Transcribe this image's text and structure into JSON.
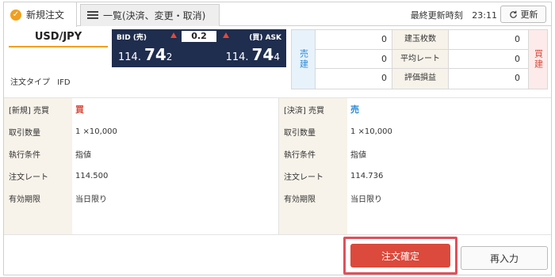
{
  "tabs": [
    {
      "label": "新規注文",
      "icon": "check-circle-icon"
    },
    {
      "label": "一覧(決済、変更・取消)",
      "icon": "list-icon"
    }
  ],
  "header": {
    "updated_label": "最終更新時刻",
    "updated_time": "23:11",
    "refresh_label": "更新"
  },
  "symbol": "USD/JPY",
  "order_type": {
    "label": "注文タイプ",
    "value": "IFD"
  },
  "quote": {
    "bid_label": "BID (売)",
    "ask_label": "(買) ASK",
    "spread": "0.2",
    "bid": {
      "big": "114.",
      "main": "74",
      "small": "2"
    },
    "ask": {
      "big": "114.",
      "main": "74",
      "small": "4"
    }
  },
  "position": {
    "sell_label": "売建",
    "buy_label": "買建",
    "rows": [
      {
        "label": "建玉枚数",
        "sell": "0",
        "buy": "0"
      },
      {
        "label": "平均レート",
        "sell": "0",
        "buy": "0"
      },
      {
        "label": "評価損益",
        "sell": "0",
        "buy": "0"
      }
    ]
  },
  "new_order": {
    "rows": [
      {
        "label": "[新規] 売買",
        "value": "買"
      },
      {
        "label": "取引数量",
        "value": "1 ×10,000"
      },
      {
        "label": "執行条件",
        "value": "指値"
      },
      {
        "label": "注文レート",
        "value": "114.500"
      },
      {
        "label": "有効期限",
        "value": "当日限り"
      }
    ]
  },
  "close_order": {
    "rows": [
      {
        "label": "[決済] 売買",
        "value": "売"
      },
      {
        "label": "取引数量",
        "value": "1 ×10,000"
      },
      {
        "label": "執行条件",
        "value": "指値"
      },
      {
        "label": "注文レート",
        "value": "114.736"
      },
      {
        "label": "有効期限",
        "value": "当日限り"
      }
    ]
  },
  "buttons": {
    "confirm": "注文確定",
    "reenter": "再入力"
  },
  "colors": {
    "accent": "#f0a020",
    "buy": "#d94a3c",
    "sell": "#2a8ad8",
    "quote_bg": "#1f2d4e"
  }
}
